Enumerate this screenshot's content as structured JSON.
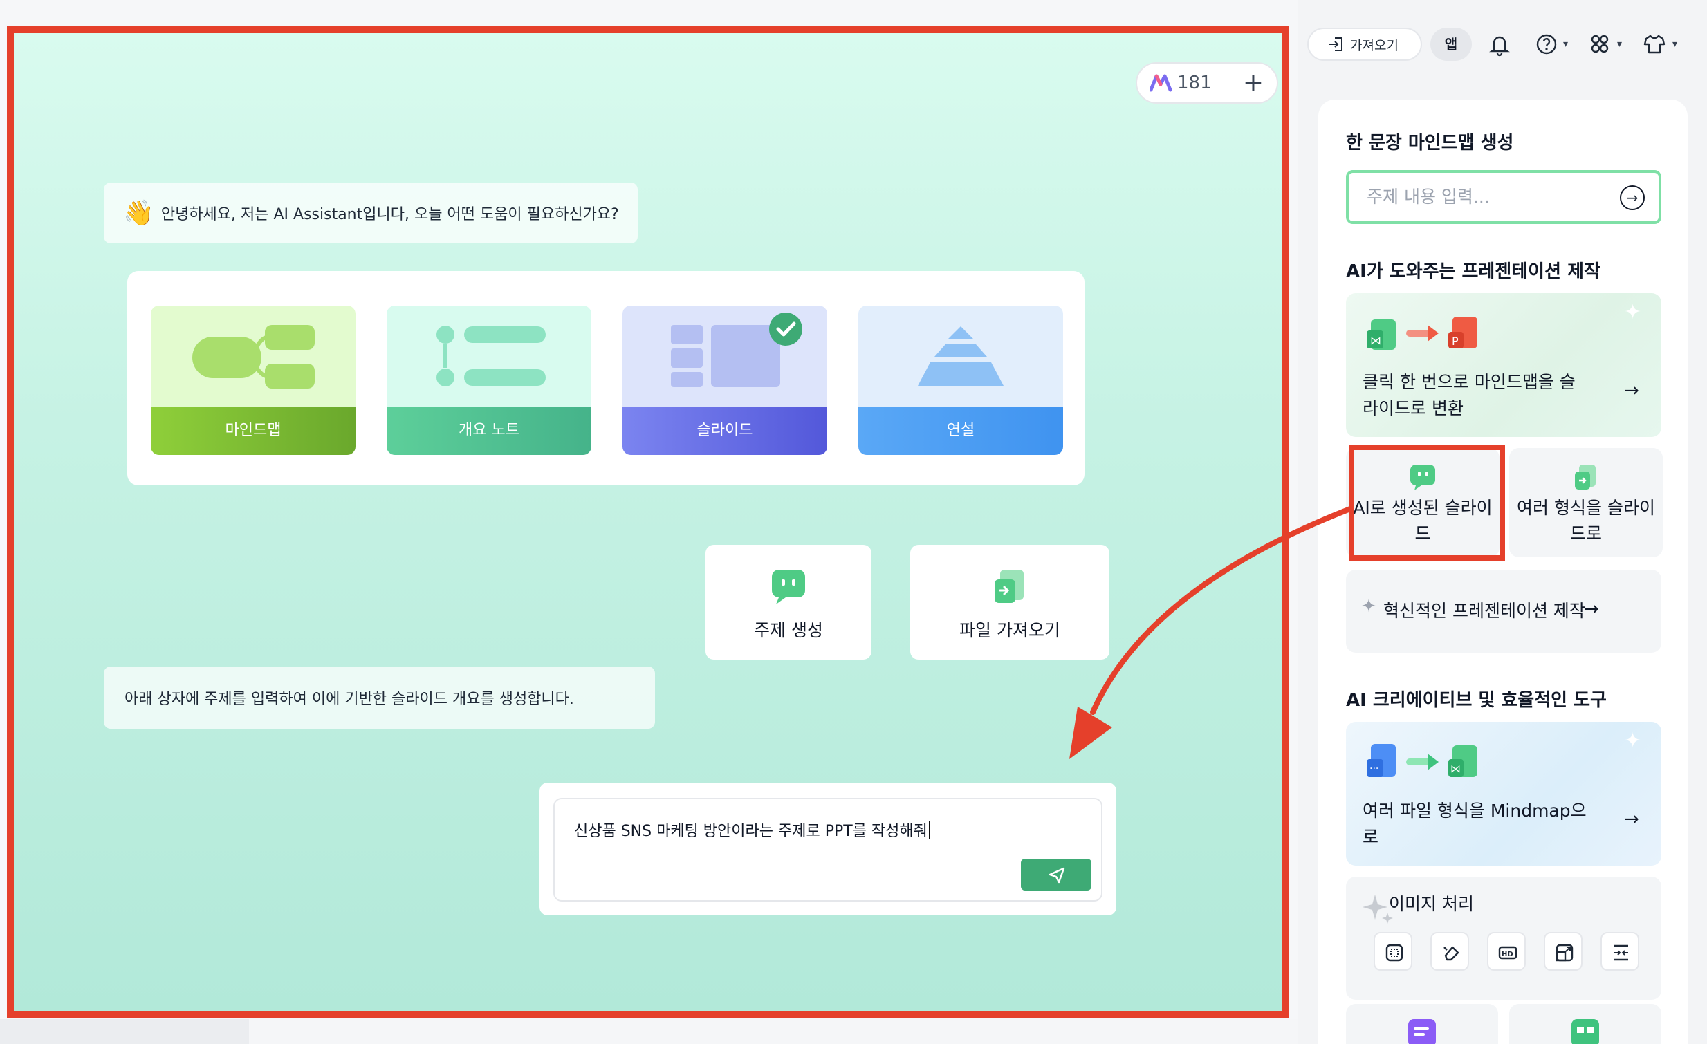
{
  "canvas": {
    "credits": "181",
    "greeting": "안녕하세요, 저는 AI Assistant입니다, 오늘 어떤 도움이 필요하신가요?",
    "modes": [
      {
        "label": "마인드맵",
        "selected": false
      },
      {
        "label": "개요 노트",
        "selected": false
      },
      {
        "label": "슬라이드",
        "selected": true
      },
      {
        "label": "연설",
        "selected": false
      }
    ],
    "actions": [
      {
        "label": "주제 생성",
        "icon": "chat-bot-icon"
      },
      {
        "label": "파일 가져오기",
        "icon": "file-import-icon"
      }
    ],
    "hint": "아래 상자에 주제를 입력하여 이에 기반한 슬라이드 개요를 생성합니다.",
    "prompt_value": "신상품 SNS 마케팅 방안이라는 주제로 PPT를 작성해줘"
  },
  "topbar": {
    "import_label": "가져오기",
    "app_label": "앱"
  },
  "sidebar": {
    "one_sentence_title": "한 문장 마인드맵 생성",
    "topic_placeholder": "주제 내용 입력...",
    "ai_presentation_title": "AI가 도와주는 프레젠테이션 제작",
    "convert_card": "클릭 한 번으로 마인드맵을 슬라이드로 변환",
    "ai_slides": "AI로 생성된 슬라이드",
    "multi_format_slides": "여러 형식을 슬라이드로",
    "innovative": "혁신적인 프레젠테이션 제작",
    "creative_tools_title": "AI 크리에이티브 및 효율적인 도구",
    "files_to_mindmap": "여러 파일 형식을 Mindmap으로",
    "image_processing": "이미지 처리",
    "image_tools": [
      "crop-icon",
      "eraser-icon",
      "hd-icon",
      "resize-icon",
      "expand-icon"
    ]
  },
  "colors": {
    "highlight": "#e5402b",
    "accent_green": "#3eaa75",
    "input_border": "#7fe0a6"
  }
}
